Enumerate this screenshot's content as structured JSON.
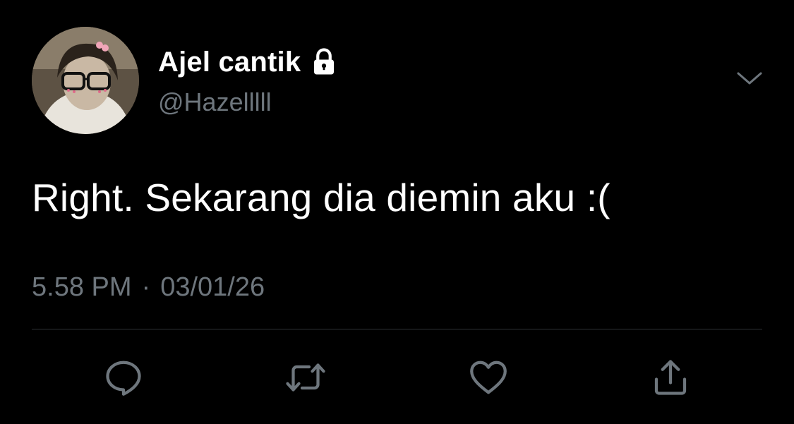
{
  "tweet": {
    "author": {
      "display_name": "Ajel cantik",
      "handle": "@Hazelllll",
      "protected_icon": "lock-icon"
    },
    "text": "Right. Sekarang dia diemin aku :(",
    "time": "5.58 PM",
    "separator": "·",
    "date": "03/01/26",
    "menu_icon": "chevron-down-icon",
    "actions": [
      {
        "icon": "reply-icon"
      },
      {
        "icon": "retweet-icon"
      },
      {
        "icon": "like-icon"
      },
      {
        "icon": "share-icon"
      }
    ]
  },
  "colors": {
    "background": "#000000",
    "primary_text": "#ffffff",
    "secondary_text": "#6e767d",
    "divider": "#2f3336"
  }
}
